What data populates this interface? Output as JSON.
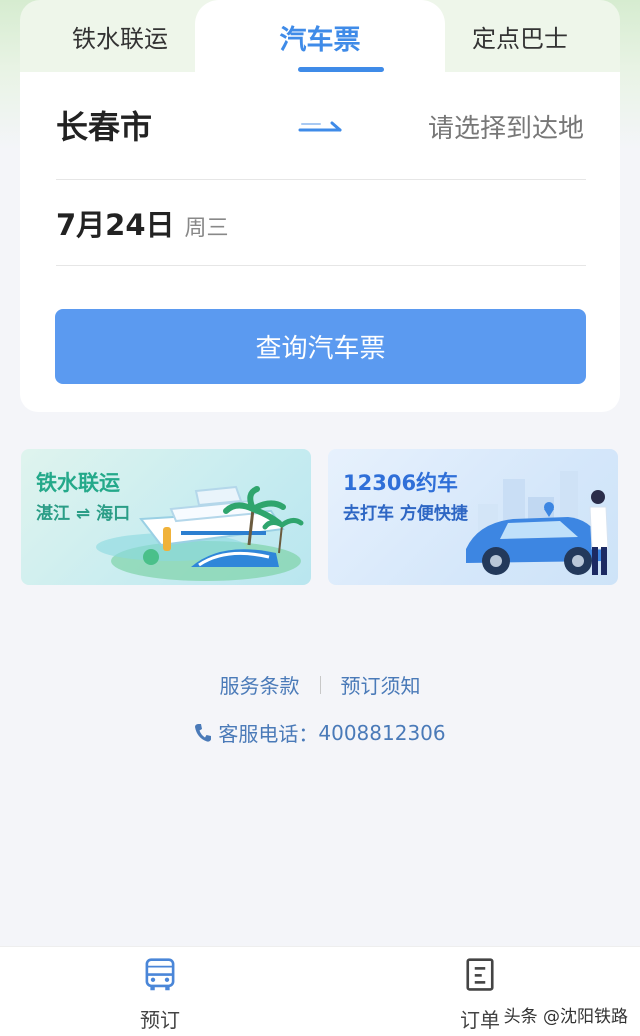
{
  "tabs": [
    {
      "label": "铁水联运"
    },
    {
      "label": "汽车票"
    },
    {
      "label": "定点巴士"
    }
  ],
  "search": {
    "from_city": "长春市",
    "to_placeholder": "请选择到达地",
    "date": "7月24日",
    "weekday": "周三",
    "button_label": "查询汽车票"
  },
  "banners": [
    {
      "title": "铁水联运",
      "subtitle": "湛江 ⇌ 海口"
    },
    {
      "title": "12306约车",
      "subtitle": "去打车 方便快捷"
    }
  ],
  "links": {
    "terms": "服务条款",
    "notice": "预订须知"
  },
  "hotline": {
    "label": "客服电话：",
    "number": "4008812306"
  },
  "bottom_nav": [
    {
      "label": "预订",
      "icon": "bus-icon"
    },
    {
      "label": "订单",
      "icon": "document-icon"
    }
  ],
  "watermark": "头条 @沈阳铁路",
  "colors": {
    "accent": "#3f8be8",
    "button": "#5b9af0",
    "link": "#4a7ab8",
    "background": "#f4f5f9"
  }
}
